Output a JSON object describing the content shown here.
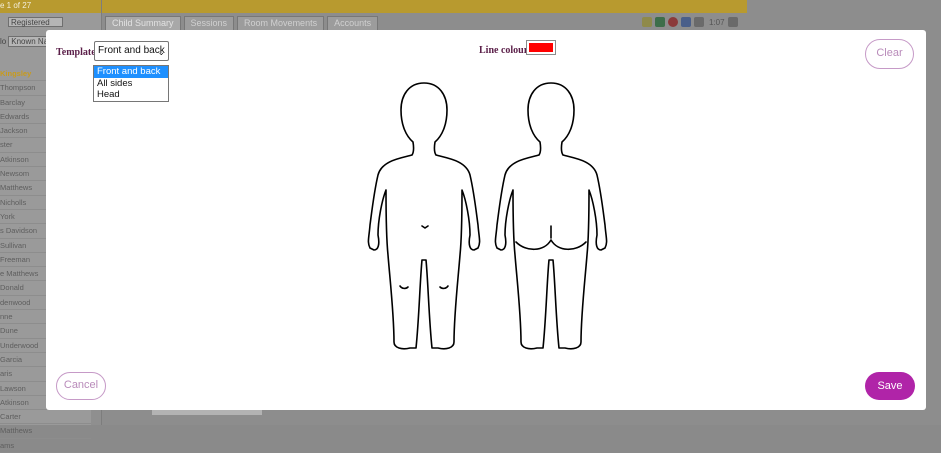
{
  "background": {
    "counter": "e 1 of 27",
    "status_select": "Registered",
    "known_prefix": "lo",
    "known_button": "Known Nam",
    "names": [
      "Kingsley",
      "Thompson",
      "Barclay",
      "Edwards",
      "Jackson",
      "ster",
      "Atkinson",
      "Newsom",
      "Matthews",
      "Nicholls",
      "York",
      "s Davidson",
      "Sullivan",
      "Freeman",
      "e Matthews",
      "Donald",
      "denwood",
      "nne",
      "Dune",
      "Underwood",
      "Garcia",
      "aris",
      "Lawson",
      "Atkinson",
      "Carter",
      "Matthews",
      "ams"
    ],
    "tabs": [
      "Child Summary",
      "Sessions",
      "Room Movements",
      "Accounts"
    ],
    "time": "1:07"
  },
  "modal": {
    "template_label": "Template",
    "template_selected": "Front and back",
    "template_options": [
      "Front and back",
      "All sides",
      "Head"
    ],
    "line_colour_label": "Line colour",
    "line_colour": "#ff0000",
    "clear_label": "Clear",
    "cancel_label": "Cancel",
    "save_label": "Save",
    "accent_color": "#b024a8"
  }
}
